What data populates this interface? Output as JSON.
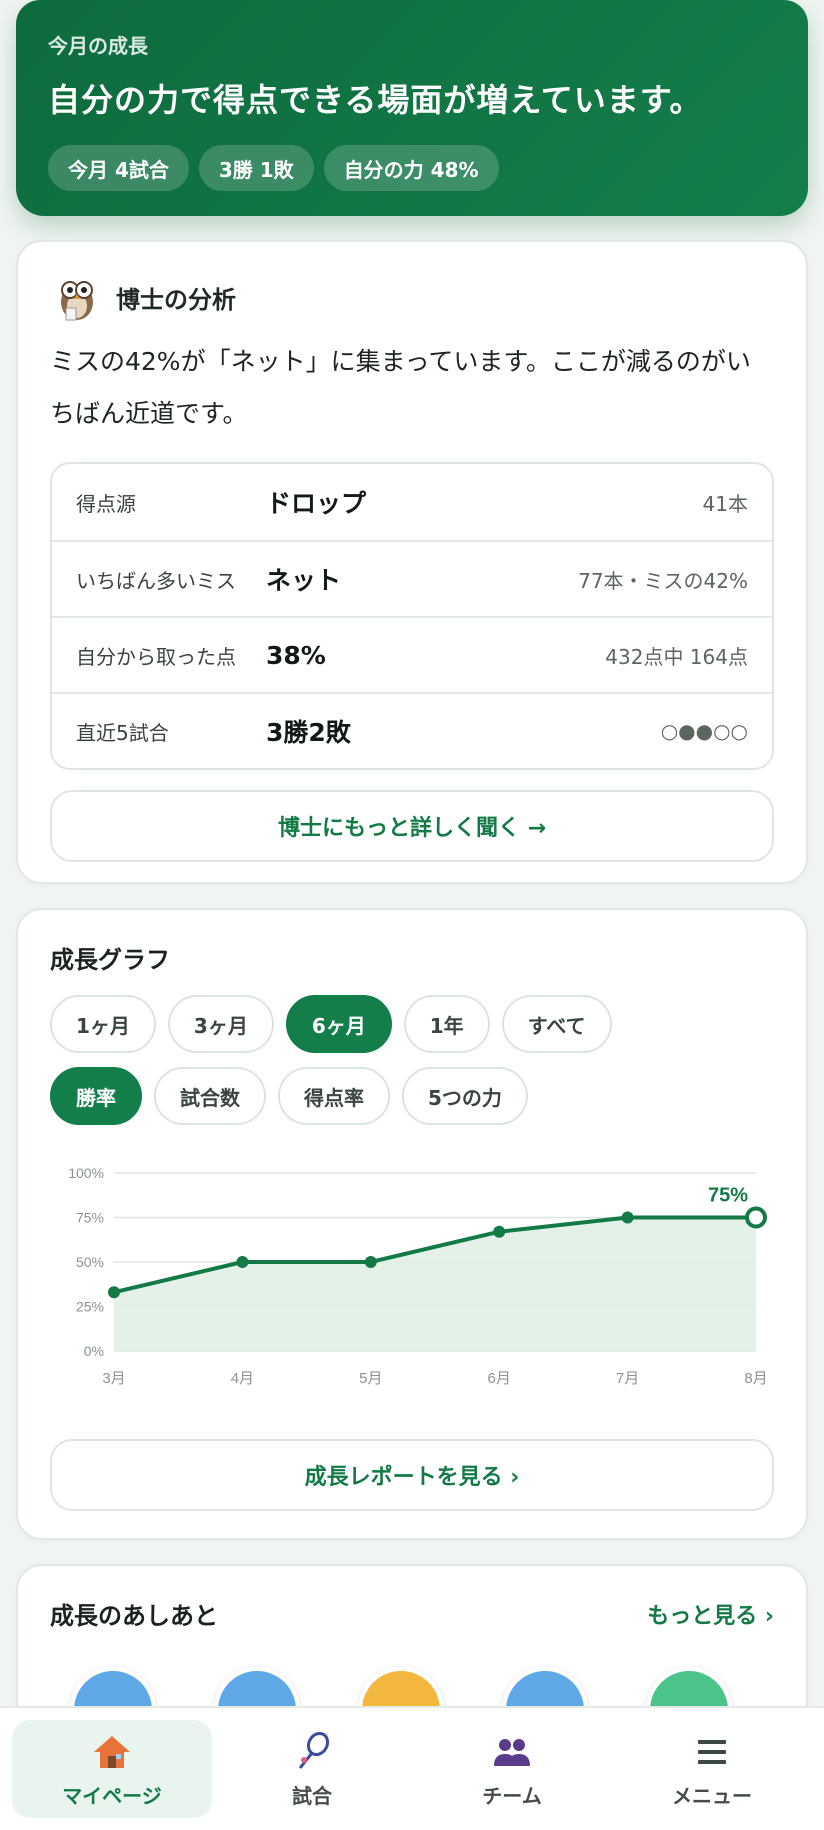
{
  "hero": {
    "eyebrow": "今月の成長",
    "headline": "自分の力で得点できる場面が増えています。",
    "chips": [
      "今月 4試合",
      "3勝 1敗",
      "自分の力 48%"
    ]
  },
  "analysis": {
    "title": "博士の分析",
    "text": "ミスの42%が「ネット」に集まっています。ここが減るのがいちばん近道です。",
    "rows": [
      {
        "label": "得点源",
        "value": "ドロップ",
        "note": "41本"
      },
      {
        "label": "いちばん多いミス",
        "value": "ネット",
        "note": "77本・ミスの42%"
      },
      {
        "label": "自分から取った点",
        "value": "38%",
        "note": "432点中 164点"
      },
      {
        "label": "直近5試合",
        "value": "3勝2敗",
        "note": "○●●○○"
      }
    ],
    "ask_button": "博士にもっと詳しく聞く →"
  },
  "growth": {
    "title": "成長グラフ",
    "period_tabs": [
      "1ヶ月",
      "3ヶ月",
      "6ヶ月",
      "1年",
      "すべて"
    ],
    "active_period": "6ヶ月",
    "metric_tabs": [
      "勝率",
      "試合数",
      "得点率",
      "5つの力"
    ],
    "active_metric": "勝率",
    "report_button": "成長レポートを見る ›"
  },
  "chart_data": {
    "type": "area",
    "categories": [
      "3月",
      "4月",
      "5月",
      "6月",
      "7月",
      "8月"
    ],
    "values": [
      33,
      50,
      50,
      67,
      75,
      75
    ],
    "ylim": [
      0,
      100
    ],
    "yticks": [
      "0%",
      "25%",
      "50%",
      "75%",
      "100%"
    ],
    "last_label": "75%",
    "grid": true,
    "colors": {
      "line": "#137a46",
      "fill": "#e0efe6"
    }
  },
  "footprints": {
    "title": "成長のあしあと",
    "more": "もっと見る ›",
    "badge_colors": [
      "#5fa8e6",
      "#5fa8e6",
      "#f3b63f",
      "#5fa8e6",
      "#4cc38a"
    ]
  },
  "nav": {
    "items": [
      {
        "label": "マイページ",
        "icon": "house-icon"
      },
      {
        "label": "試合",
        "icon": "racket-icon"
      },
      {
        "label": "チーム",
        "icon": "team-icon"
      },
      {
        "label": "メニュー",
        "icon": "menu-icon"
      }
    ]
  }
}
